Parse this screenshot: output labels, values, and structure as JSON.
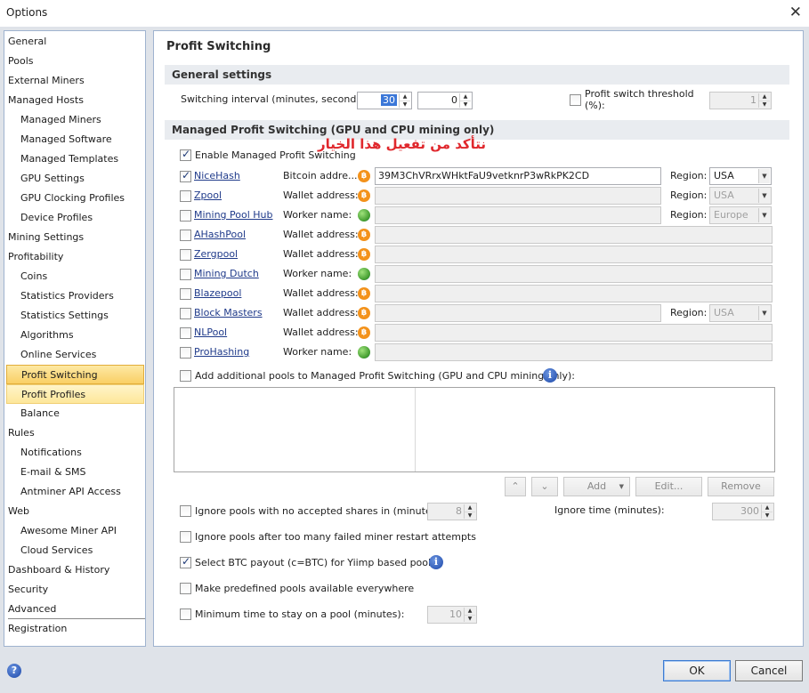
{
  "window": {
    "title": "Options",
    "close": "✕"
  },
  "nav": {
    "items": [
      {
        "label": "General",
        "level": 0
      },
      {
        "label": "Pools",
        "level": 0
      },
      {
        "label": "External Miners",
        "level": 0
      },
      {
        "label": "Managed Hosts",
        "level": 0
      },
      {
        "label": "Managed Miners",
        "level": 1
      },
      {
        "label": "Managed Software",
        "level": 1
      },
      {
        "label": "Managed Templates",
        "level": 1
      },
      {
        "label": "GPU Settings",
        "level": 1
      },
      {
        "label": "GPU Clocking Profiles",
        "level": 1
      },
      {
        "label": "Device Profiles",
        "level": 1
      },
      {
        "label": "Mining Settings",
        "level": 0
      },
      {
        "label": "Profitability",
        "level": 0
      },
      {
        "label": "Coins",
        "level": 1
      },
      {
        "label": "Statistics Providers",
        "level": 1
      },
      {
        "label": "Statistics Settings",
        "level": 1
      },
      {
        "label": "Algorithms",
        "level": 1
      },
      {
        "label": "Online Services",
        "level": 1
      },
      {
        "label": "Profit Switching",
        "level": 1,
        "state": "selected"
      },
      {
        "label": "Profit Profiles",
        "level": 1,
        "state": "hover"
      },
      {
        "label": "Balance",
        "level": 1
      },
      {
        "label": "Rules",
        "level": 0
      },
      {
        "label": "Notifications",
        "level": 1
      },
      {
        "label": "E-mail & SMS",
        "level": 1
      },
      {
        "label": "Antminer API Access",
        "level": 1
      },
      {
        "label": "Web",
        "level": 0
      },
      {
        "label": "Awesome Miner API",
        "level": 1
      },
      {
        "label": "Cloud Services",
        "level": 1
      },
      {
        "label": "Dashboard & History",
        "level": 0
      },
      {
        "label": "Security",
        "level": 0
      },
      {
        "label": "Advanced",
        "level": 0
      },
      {
        "label": "Registration",
        "level": 0
      }
    ]
  },
  "panel": {
    "title": "Profit Switching",
    "general": {
      "header": "General settings",
      "interval_label": "Switching interval (minutes, seconds):",
      "interval_minutes": "30",
      "interval_seconds": "0",
      "threshold_label_1": "Profit switch threshold",
      "threshold_label_2": "(%):",
      "threshold_value": "1"
    },
    "managed": {
      "header": "Managed Profit Switching (GPU and CPU mining only)",
      "enable_label": "Enable Managed Profit Switching",
      "annotation": "نتأكد من تفعيل هذا الخيار",
      "pools": [
        {
          "name": "NiceHash",
          "checked": true,
          "field_label": "Bitcoin addre...",
          "icon": "bitcoin-icon",
          "value": "39M3ChVRrxWHktFaU9vetknrP3wRkPK2CD",
          "enabled": true,
          "region": "USA",
          "region_enabled": true
        },
        {
          "name": "Zpool",
          "checked": false,
          "field_label": "Wallet address:",
          "icon": "bitcoin-icon",
          "value": "",
          "enabled": false,
          "region": "USA",
          "region_enabled": false
        },
        {
          "name": "Mining Pool Hub",
          "checked": false,
          "field_label": "Worker name:",
          "icon": "globe-icon",
          "value": "",
          "enabled": false,
          "region": "Europe",
          "region_enabled": false
        },
        {
          "name": "AHashPool",
          "checked": false,
          "field_label": "Wallet address:",
          "icon": "bitcoin-icon",
          "value": "",
          "enabled": false
        },
        {
          "name": "Zergpool",
          "checked": false,
          "field_label": "Wallet address:",
          "icon": "bitcoin-icon",
          "value": "",
          "enabled": false
        },
        {
          "name": "Mining Dutch",
          "checked": false,
          "field_label": "Worker name:",
          "icon": "globe-icon",
          "value": "",
          "enabled": false
        },
        {
          "name": "Blazepool",
          "checked": false,
          "field_label": "Wallet address:",
          "icon": "bitcoin-icon",
          "value": "",
          "enabled": false
        },
        {
          "name": "Block Masters",
          "checked": false,
          "field_label": "Wallet address:",
          "icon": "bitcoin-icon",
          "value": "",
          "enabled": false,
          "region": "USA",
          "region_enabled": false
        },
        {
          "name": "NLPool",
          "checked": false,
          "field_label": "Wallet address:",
          "icon": "bitcoin-icon",
          "value": "",
          "enabled": false
        },
        {
          "name": "ProHashing",
          "checked": false,
          "field_label": "Worker name:",
          "icon": "globe-icon",
          "value": "",
          "enabled": false
        }
      ],
      "region_label": "Region:",
      "additional_label": "Add additional pools to Managed Profit Switching (GPU and CPU mining only):"
    },
    "list_buttons": {
      "up": "⌃",
      "down": "⌄",
      "add": "Add",
      "edit": "Edit...",
      "remove": "Remove"
    },
    "options": {
      "ignore_no_shares_label": "Ignore pools with no accepted shares in (minutes):",
      "ignore_no_shares_value": "8",
      "ignore_time_label": "Ignore time (minutes):",
      "ignore_time_value": "300",
      "ignore_failed_label": "Ignore pools after too many failed miner restart attempts",
      "btc_payout_label": "Select BTC payout (c=BTC) for Yiimp based pools",
      "btc_payout_checked": true,
      "predefined_label": "Make predefined pools available everywhere",
      "min_time_label": "Minimum time to stay on a pool (minutes):",
      "min_time_value": "10"
    }
  },
  "footer": {
    "help": "?",
    "ok": "OK",
    "cancel": "Cancel"
  }
}
